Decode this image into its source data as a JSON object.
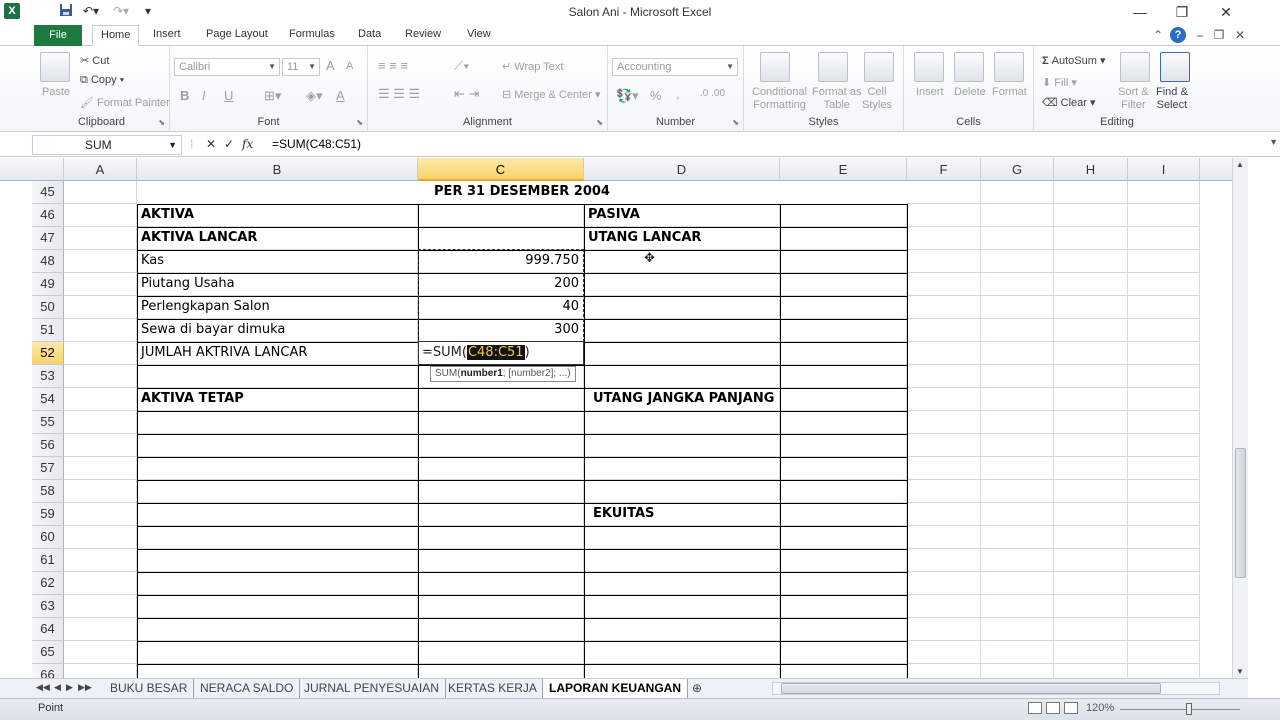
{
  "titlebar": {
    "app_icon": "X",
    "title": "Salon Ani - Microsoft Excel",
    "qat_icons": [
      "save-icon",
      "undo-icon",
      "redo-icon",
      "customize-qat-icon"
    ],
    "window_buttons": [
      "minimize-icon",
      "restore-icon",
      "close-icon"
    ]
  },
  "tabs": {
    "file": "File",
    "items": [
      "Home",
      "Insert",
      "Page Layout",
      "Formulas",
      "Data",
      "Review",
      "View"
    ],
    "active": "Home"
  },
  "ribbon": {
    "clipboard": {
      "label": "Clipboard",
      "paste": "Paste",
      "cut": "Cut",
      "copy": "Copy",
      "format_painter": "Format Painter"
    },
    "font": {
      "label": "Font",
      "family": "Calibri",
      "size": "11",
      "bold": "B",
      "italic": "I",
      "underline": "U",
      "grow": "A",
      "shrink": "A",
      "color": "A"
    },
    "alignment": {
      "label": "Alignment",
      "wrap_text": "Wrap Text",
      "merge_center": "Merge & Center"
    },
    "number": {
      "label": "Number",
      "format": "Accounting",
      "percent": "%",
      "comma": ","
    },
    "styles": {
      "label": "Styles",
      "conditional": [
        "Conditional",
        "Formatting"
      ],
      "format_table": [
        "Format as",
        "Table"
      ],
      "cell_styles": [
        "Cell",
        "Styles"
      ]
    },
    "cells": {
      "label": "Cells",
      "insert": "Insert",
      "delete": "Delete",
      "format": "Format"
    },
    "editing": {
      "label": "Editing",
      "autosum": "AutoSum",
      "fill": "Fill",
      "clear": "Clear",
      "sort": [
        "Sort &",
        "Filter"
      ],
      "find": [
        "Find &",
        "Select"
      ]
    }
  },
  "formula_bar": {
    "name_box": "SUM",
    "cancel": "✕",
    "enter": "✓",
    "fx": "fx",
    "formula": "=SUM(C48:C51)"
  },
  "columns": [
    "A",
    "B",
    "C",
    "D",
    "E",
    "F",
    "G",
    "H",
    "I"
  ],
  "rows": [
    "45",
    "46",
    "47",
    "48",
    "49",
    "50",
    "51",
    "52",
    "53",
    "54",
    "55",
    "56",
    "57",
    "58",
    "59",
    "60",
    "61",
    "62",
    "63",
    "64",
    "65",
    "66"
  ],
  "cells": {
    "r45": {
      "title": "PER 31 DESEMBER 2004"
    },
    "r46": {
      "b": "AKTIVA",
      "d": "PASIVA"
    },
    "r47": {
      "b": "AKTIVA LANCAR",
      "d": "UTANG LANCAR"
    },
    "r48": {
      "b": "Kas",
      "c": "999.750"
    },
    "r49": {
      "b": "Piutang Usaha",
      "c": "200"
    },
    "r50": {
      "b": "Perlengkapan Salon",
      "c": "40"
    },
    "r51": {
      "b": "Sewa di bayar dimuka",
      "c": "300"
    },
    "r52": {
      "b": "JUMLAH AKTRIVA LANCAR"
    },
    "r54": {
      "b": "AKTIVA TETAP",
      "d": "UTANG JANGKA PANJANG"
    },
    "r59": {
      "d": "EKUITAS"
    }
  },
  "editing_cell": {
    "prefix": "=SUM(",
    "ref": "C48:C51",
    "suffix": ")"
  },
  "tooltip": {
    "fn": "SUM(",
    "arg1": "number1",
    "rest": "; [number2]; ...)"
  },
  "sheets": [
    "BUKU BESAR",
    "NERACA SALDO",
    "JURNAL PENYESUAIAN",
    "KERTAS KERJA",
    "LAPORAN KEUANGAN"
  ],
  "active_sheet": "LAPORAN KEUANGAN",
  "statusbar": {
    "mode": "Point",
    "zoom": "120%"
  }
}
